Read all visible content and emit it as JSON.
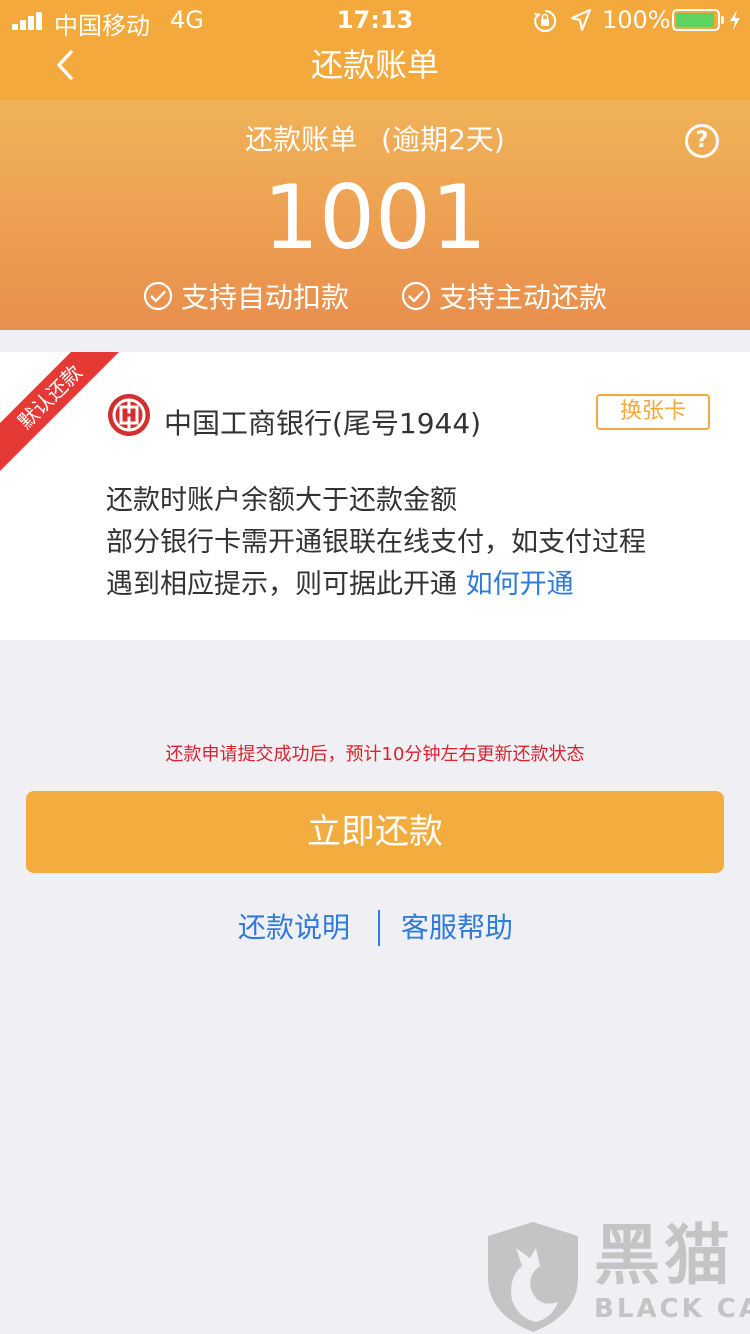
{
  "status_bar": {
    "carrier": "中国移动",
    "network": "4G",
    "time": "17:13",
    "battery_percent": "100%",
    "battery_level": 0.95
  },
  "nav": {
    "title": "还款账单",
    "back_icon": "chevron-left-icon"
  },
  "bill": {
    "title": "还款账单",
    "overdue": "(逾期2天)",
    "amount": "1001",
    "help_icon_glyph": "?",
    "features": [
      {
        "label": "支持自动扣款"
      },
      {
        "label": "支持主动还款"
      }
    ]
  },
  "card": {
    "ribbon": "默认还款",
    "bank_name": "中国工商银行(尾号1944)",
    "change_label": "换张卡",
    "desc_line1": "还款时账户余额大于还款金额",
    "desc_line2": "部分银行卡需开通银联在线支付，如支付过程",
    "desc_line3": "遇到相应提示，则可据此开通",
    "how_link": "如何开通"
  },
  "notice": "还款申请提交成功后，预计10分钟左右更新还款状态",
  "pay_button": "立即还款",
  "links": {
    "repay_info": "还款说明",
    "support": "客服帮助"
  },
  "watermark": {
    "title": "黑猫",
    "subtitle": "BLACK CAT"
  },
  "colors": {
    "brand": "#f3a93c",
    "link": "#2f7bd9",
    "alert": "#d9232d",
    "ribbon": "#e53935"
  }
}
